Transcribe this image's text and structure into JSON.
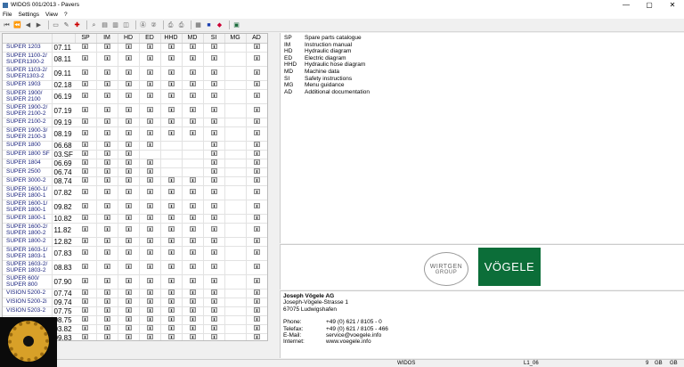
{
  "window": {
    "title": "WIDOS 001/2013 - Pavers",
    "minimize": "—",
    "maximize": "▢",
    "close": "✕"
  },
  "menu": [
    "File",
    "Settings",
    "View",
    "?"
  ],
  "columns": [
    "SP",
    "IM",
    "HD",
    "ED",
    "HHD",
    "MD",
    "SI",
    "MG",
    "AD"
  ],
  "rows": [
    {
      "name": "SUPER 1203",
      "code": "07.11",
      "avail": [
        1,
        1,
        1,
        1,
        1,
        1,
        1,
        0,
        1
      ]
    },
    {
      "name": "SUPER 1100-2/ SUPER1300-2",
      "code": "08.11",
      "avail": [
        1,
        1,
        1,
        1,
        1,
        1,
        1,
        0,
        1
      ]
    },
    {
      "name": "SUPER 1103-2/ SUPER1303-2",
      "code": "09.11",
      "avail": [
        1,
        1,
        1,
        1,
        1,
        1,
        1,
        0,
        1
      ]
    },
    {
      "name": "SUPER 1903",
      "code": "02.18",
      "avail": [
        1,
        1,
        1,
        1,
        1,
        1,
        1,
        0,
        1
      ]
    },
    {
      "name": "SUPER 1900/ SUPER 2100",
      "code": "06.19",
      "avail": [
        1,
        1,
        1,
        1,
        1,
        1,
        1,
        0,
        1
      ]
    },
    {
      "name": "SUPER 1900-2/ SUPER 2100-2",
      "code": "07.19",
      "avail": [
        1,
        1,
        1,
        1,
        1,
        1,
        1,
        0,
        1
      ]
    },
    {
      "name": "SUPER 2100-2",
      "code": "09.19",
      "avail": [
        1,
        1,
        1,
        1,
        1,
        1,
        1,
        0,
        1
      ]
    },
    {
      "name": "SUPER 1900-3/ SUPER 2100-3",
      "code": "08.19",
      "avail": [
        1,
        1,
        1,
        1,
        1,
        1,
        1,
        0,
        1
      ]
    },
    {
      "name": "SUPER 1800",
      "code": "06.68",
      "avail": [
        1,
        1,
        1,
        1,
        0,
        0,
        1,
        0,
        1
      ]
    },
    {
      "name": "SUPER 1800 SF",
      "code": "03.SF",
      "avail": [
        1,
        1,
        1,
        0,
        0,
        0,
        1,
        0,
        1
      ]
    },
    {
      "name": "SUPER 1804",
      "code": "06.69",
      "avail": [
        1,
        1,
        1,
        1,
        0,
        0,
        1,
        0,
        1
      ]
    },
    {
      "name": "SUPER 2500",
      "code": "06.74",
      "avail": [
        1,
        1,
        1,
        1,
        0,
        0,
        1,
        0,
        1
      ]
    },
    {
      "name": "SUPER 3000-2",
      "code": "08.74",
      "avail": [
        1,
        1,
        1,
        1,
        1,
        1,
        1,
        0,
        1
      ]
    },
    {
      "name": "SUPER 1600-1/ SUPER 1800-1",
      "code": "07.82",
      "avail": [
        1,
        1,
        1,
        1,
        1,
        1,
        1,
        0,
        1
      ]
    },
    {
      "name": "SUPER 1600-1/ SUPER 1800-1",
      "code": "09.82",
      "avail": [
        1,
        1,
        1,
        1,
        1,
        1,
        1,
        0,
        1
      ]
    },
    {
      "name": "SUPER 1800-1",
      "code": "10.82",
      "avail": [
        1,
        1,
        1,
        1,
        1,
        1,
        1,
        0,
        1
      ]
    },
    {
      "name": "SUPER 1600-2/ SUPER 1800-2",
      "code": "11.82",
      "avail": [
        1,
        1,
        1,
        1,
        1,
        1,
        1,
        0,
        1
      ]
    },
    {
      "name": "SUPER 1800-2",
      "code": "12.82",
      "avail": [
        1,
        1,
        1,
        1,
        1,
        1,
        1,
        0,
        1
      ]
    },
    {
      "name": "SUPER 1603-1/ SUPER 1803-1",
      "code": "07.83",
      "avail": [
        1,
        1,
        1,
        1,
        1,
        1,
        1,
        0,
        1
      ]
    },
    {
      "name": "SUPER 1603-2/ SUPER 1803-2",
      "code": "08.83",
      "avail": [
        1,
        1,
        1,
        1,
        1,
        1,
        1,
        0,
        1
      ]
    },
    {
      "name": "SUPER 600/ SUPER 800",
      "code": "07.90",
      "avail": [
        1,
        1,
        1,
        1,
        1,
        1,
        1,
        0,
        1
      ]
    },
    {
      "name": "VISION 5200-2",
      "code": "07.74",
      "avail": [
        1,
        1,
        1,
        1,
        1,
        1,
        1,
        0,
        1
      ]
    },
    {
      "name": "VISION 5200-2i",
      "code": "09.74",
      "avail": [
        1,
        1,
        1,
        1,
        1,
        1,
        1,
        0,
        1
      ]
    },
    {
      "name": "VISION 5203-2",
      "code": "07.75",
      "avail": [
        1,
        1,
        1,
        1,
        1,
        1,
        1,
        0,
        1
      ]
    },
    {
      "name": "",
      "code": "08.75",
      "avail": [
        1,
        1,
        1,
        1,
        1,
        1,
        1,
        0,
        1
      ]
    },
    {
      "name": "",
      "code": "03.82",
      "avail": [
        1,
        1,
        1,
        1,
        1,
        1,
        1,
        0,
        1
      ]
    },
    {
      "name": "",
      "code": "09.83",
      "avail": [
        1,
        1,
        1,
        1,
        1,
        1,
        1,
        0,
        1
      ]
    }
  ],
  "legend": [
    [
      "SP",
      "Spare parts catalogue"
    ],
    [
      "IM",
      "Instruction manual"
    ],
    [
      "HD",
      "Hydraulic diagram"
    ],
    [
      "ED",
      "Electric diagram"
    ],
    [
      "HHD",
      "Hydraulic hose diagram"
    ],
    [
      "MD",
      "Machine data"
    ],
    [
      "SI",
      "Safety instructions"
    ],
    [
      "MG",
      "Menu guidance"
    ],
    [
      "AD",
      "Additional documentation"
    ]
  ],
  "logos": {
    "wirtgen_line1": "WIRTGEN",
    "wirtgen_line2": "GROUP",
    "vogele": "VÖGELE"
  },
  "contact": {
    "company": "Joseph Vögele AG",
    "street": "Joseph-Vögele-Strasse 1",
    "city": "67075 Ludwigshafen",
    "phone_label": "Phone:",
    "phone": "+49 (0) 621 / 8105 - 0",
    "fax_label": "Telefax:",
    "fax": "+49 (0) 621 / 8105 - 466",
    "email_label": "E-Mail:",
    "email": "service@voegele.info",
    "web_label": "Internet:",
    "web": "www.voegele.info"
  },
  "status": {
    "app": "WIDOS",
    "version": "L1_06",
    "num": "9",
    "unit": "GB",
    "unit2": "GB"
  },
  "colors": {
    "link": "#1a237e",
    "vogele_green": "#0c6e39"
  }
}
